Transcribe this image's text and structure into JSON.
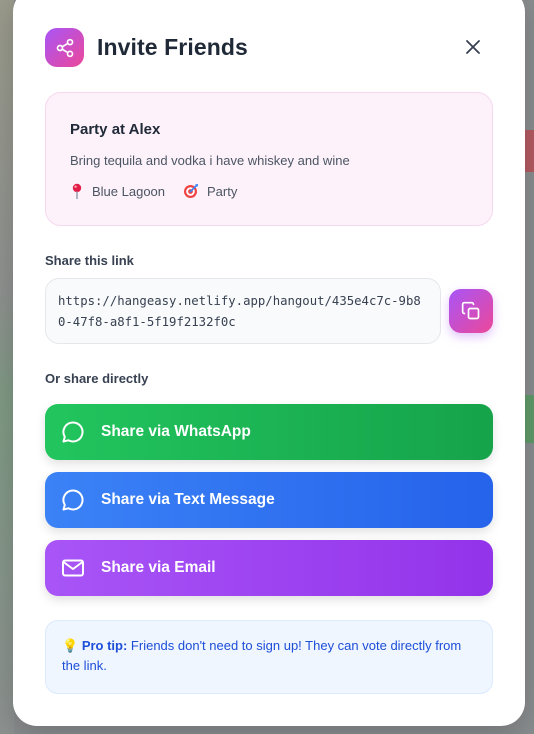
{
  "modal": {
    "title": "Invite Friends",
    "icons": {
      "header": "share-icon",
      "close": "close-icon"
    }
  },
  "event": {
    "name": "Party at Alex",
    "description": "Bring tequila and vodka i have whiskey and wine",
    "location": "Blue Lagoon",
    "category": "Party",
    "icons": {
      "location": "pin-icon",
      "category": "target-icon"
    }
  },
  "link_section": {
    "label": "Share this link",
    "url": "https://hangeasy.netlify.app/hangout/435e4c7c-9b80-47f8-a8f1-5f19f2132f0c",
    "copy_icon": "copy-icon"
  },
  "share_section": {
    "label": "Or share directly",
    "buttons": [
      {
        "label": "Share via WhatsApp",
        "icon": "chat-bubble-icon",
        "color": "#22c55e"
      },
      {
        "label": "Share via Text Message",
        "icon": "message-icon",
        "color": "#3b82f6"
      },
      {
        "label": "Share via Email",
        "icon": "mail-icon",
        "color": "#a855f7"
      }
    ]
  },
  "tip": {
    "emoji": "💡",
    "title": "Pro tip:",
    "text": " Friends don't need to sign up! They can vote directly from the link."
  },
  "colors": {
    "accent_gradient_start": "#a855f7",
    "accent_gradient_end": "#ec4899",
    "tip_text": "#1d4ed8"
  }
}
